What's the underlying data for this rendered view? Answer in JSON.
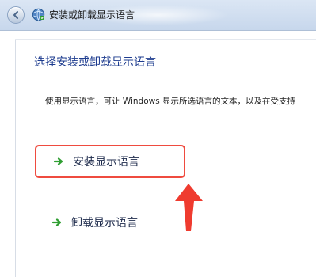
{
  "window": {
    "title": "安装或卸载显示语言"
  },
  "main": {
    "heading": "选择安装或卸载显示语言",
    "description": "使用显示语言，可让 Windows 显示所选语言的文本，以及在受支持"
  },
  "options": [
    {
      "label": "安装显示语言"
    },
    {
      "label": "卸载显示语言"
    }
  ],
  "icons": {
    "back": "back-arrow-icon",
    "app": "globe-language-icon",
    "option": "green-arrow-icon",
    "annotation": "red-pointer-arrow-icon"
  },
  "colors": {
    "title_bar": "#c7d7ec",
    "heading": "#1e3c8f",
    "option_arrow": "#2f9e32",
    "highlight_border": "#ef4b3f",
    "annotation_arrow": "#ef3b2f"
  }
}
